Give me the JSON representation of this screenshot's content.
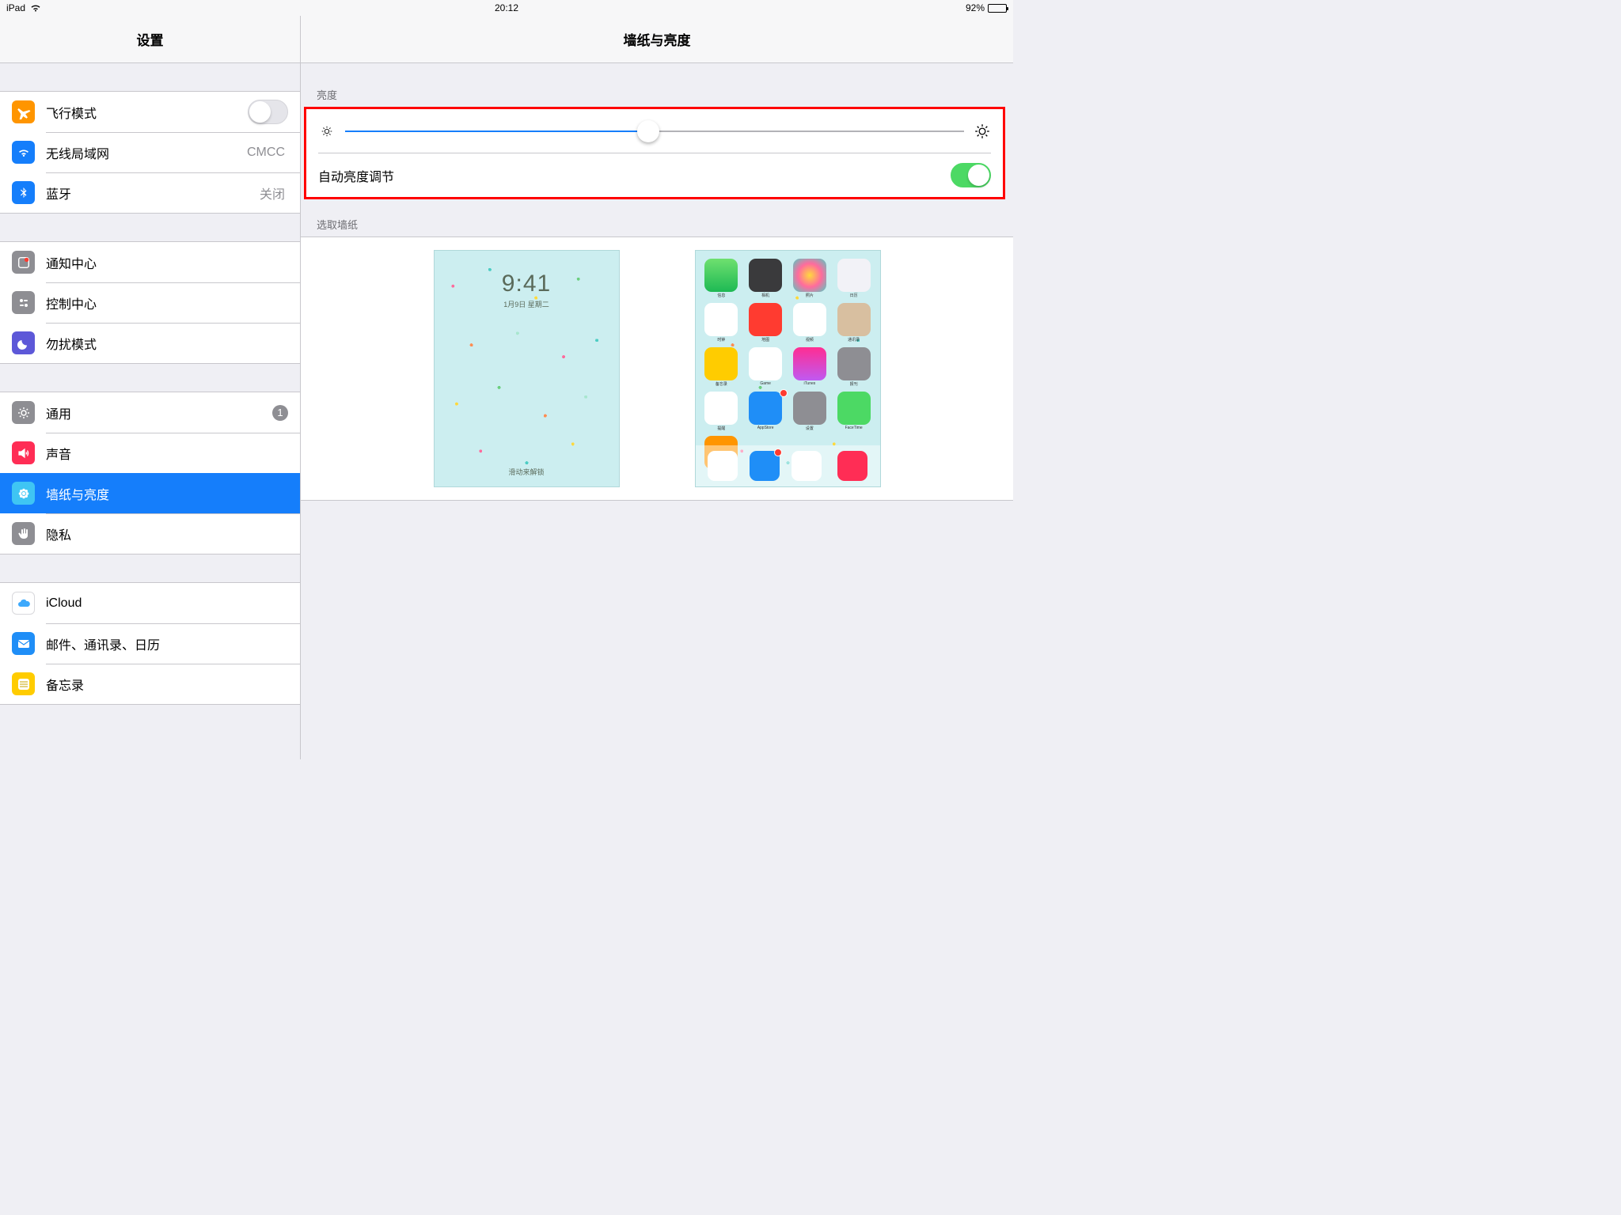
{
  "status": {
    "device": "iPad",
    "time": "20:12",
    "battery_pct": "92%"
  },
  "sidebar": {
    "title": "设置",
    "sections": [
      [
        {
          "key": "airplane",
          "label": "飞行模式",
          "switch": false
        },
        {
          "key": "wifi",
          "label": "无线局域网",
          "detail": "CMCC"
        },
        {
          "key": "bluetooth",
          "label": "蓝牙",
          "detail": "关闭"
        }
      ],
      [
        {
          "key": "notification",
          "label": "通知中心"
        },
        {
          "key": "control-center",
          "label": "控制中心"
        },
        {
          "key": "dnd",
          "label": "勿扰模式"
        }
      ],
      [
        {
          "key": "general",
          "label": "通用",
          "badge": "1"
        },
        {
          "key": "sounds",
          "label": "声音"
        },
        {
          "key": "wallpaper",
          "label": "墙纸与亮度",
          "selected": true
        },
        {
          "key": "privacy",
          "label": "隐私"
        }
      ],
      [
        {
          "key": "icloud",
          "label": "iCloud"
        },
        {
          "key": "mail",
          "label": "邮件、通讯录、日历"
        },
        {
          "key": "notes",
          "label": "备忘录"
        }
      ]
    ]
  },
  "content": {
    "title": "墙纸与亮度",
    "brightness_header": "亮度",
    "brightness_value_pct": 49,
    "auto_brightness_label": "自动亮度调节",
    "auto_brightness_on": true,
    "wallpaper_header": "选取墙纸",
    "lock_preview": {
      "time": "9:41",
      "date": "1月9日 星期二",
      "slide": "滑动来解锁"
    }
  }
}
